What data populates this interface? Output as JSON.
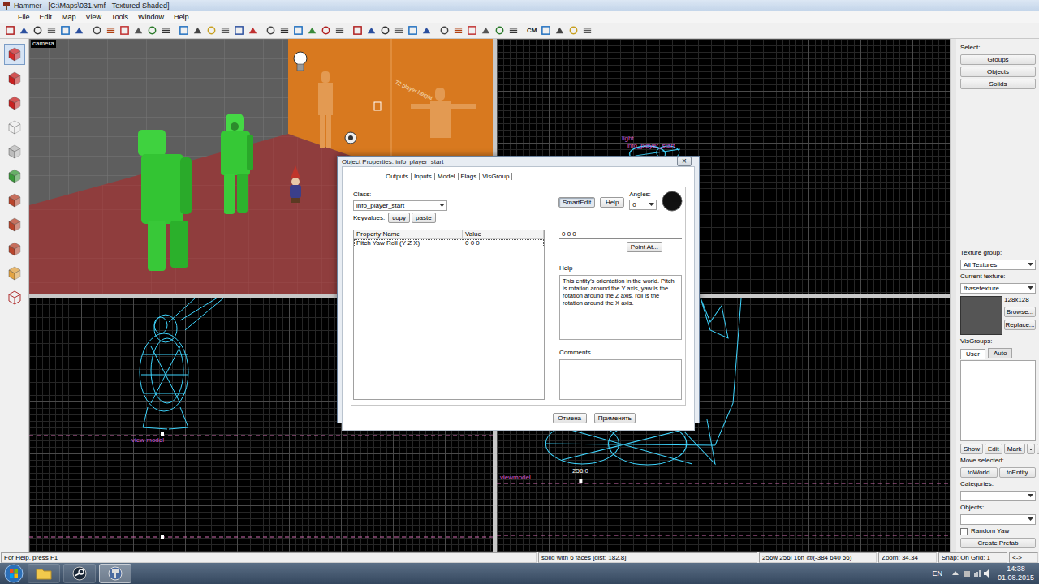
{
  "window": {
    "title": "Hammer - [C:\\Maps\\031.vmf - Textured Shaded]"
  },
  "menu": [
    "File",
    "Edit",
    "Map",
    "View",
    "Tools",
    "Window",
    "Help"
  ],
  "toolbar": {
    "text_buttons": [
      "CM"
    ]
  },
  "tools": [
    {
      "selected": true
    },
    {
      "selected": false
    },
    {
      "selected": false
    },
    {
      "selected": false
    },
    {
      "selected": false
    },
    {
      "selected": false
    },
    {
      "selected": false
    },
    {
      "selected": false
    },
    {
      "selected": false
    },
    {
      "selected": false
    },
    {
      "selected": false
    }
  ],
  "viewports": {
    "camera": {
      "title": "camera",
      "caption": "72 player height"
    },
    "top": {
      "labels": [
        "light",
        "info_player_start"
      ]
    },
    "front": {
      "labels": [
        "view model"
      ]
    },
    "side": {
      "labels": [
        "viewmodel",
        "256.0"
      ]
    }
  },
  "dialog": {
    "title": "Object Properties: info_player_start",
    "close": "×",
    "tabs": [
      {
        "label": "Outputs",
        "selected": false
      },
      {
        "label": "Inputs",
        "selected": false
      },
      {
        "label": "Model",
        "selected": false
      },
      {
        "label": "Flags",
        "selected": false
      },
      {
        "label": "VisGroup",
        "selected": false
      }
    ],
    "class_label": "Class:",
    "class_value": "info_player_start",
    "keyvalues_label": "Keyvalues:",
    "copy": "copy",
    "paste": "paste",
    "smart_edit": {
      "label": "SmartEdit",
      "on": true
    },
    "help_button": "Help",
    "angles_label": "Angles:",
    "angles_value": "0",
    "table": {
      "columns": [
        "Property Name",
        "Value"
      ],
      "rows": [
        {
          "name": "Pitch Yaw Roll (Y Z X)",
          "value": "0 0 0",
          "selected": true
        }
      ]
    },
    "value_field": "0 0 0",
    "point_at": "Point At...",
    "help_label": "Help",
    "help_text": "This entity's orientation in the world. Pitch is rotation around the Y axis, yaw is the rotation around the Z axis, roll is the rotation around the X axis.",
    "comments_label": "Comments",
    "comments": "",
    "buttons": [
      "Отмена",
      "Применить"
    ]
  },
  "side_panel": {
    "select_label": "Select:",
    "select_buttons": [
      "Groups",
      "Objects",
      "Solids"
    ],
    "texture_group_label": "Texture group:",
    "texture_group": "All Textures",
    "current_texture_label": "Current texture:",
    "current_texture": "/basetexture",
    "texture_size": "128x128",
    "browse": "Browse...",
    "replace": "Replace...",
    "visgroups_label": "VisGroups:",
    "visgroup_tabs": [
      {
        "label": "User",
        "selected": true
      },
      {
        "label": "Auto",
        "selected": false
      }
    ],
    "visgroup_buttons": [
      "Show",
      "Edit",
      "Mark"
    ],
    "move_selected_label": "Move selected:",
    "move_buttons": [
      "toWorld",
      "toEntity"
    ],
    "categories_label": "Categories:",
    "objects_label": "Objects:",
    "random_yaw": {
      "label": "Random Yaw",
      "checked": false
    },
    "create_prefab": "Create Prefab"
  },
  "status_bar": [
    "For Help, press F1",
    "solid with 6 faces [dist: 182.8]",
    "256w 256l 16h @(-384 640 56)",
    "Zoom: 34.34",
    "Snap: On Grid: 1",
    "<->"
  ],
  "taskbar": {
    "apps": [
      {
        "selected": false
      },
      {
        "selected": false
      },
      {
        "selected": true
      }
    ],
    "language": "EN",
    "time": "14:38",
    "date": "01.08.2015"
  }
}
